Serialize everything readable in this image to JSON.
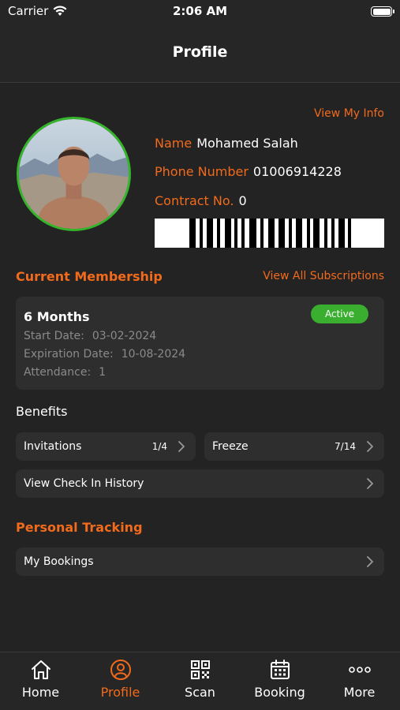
{
  "status_bar": {
    "carrier": "Carrier",
    "time": "2:06 AM"
  },
  "header": {
    "title": "Profile"
  },
  "profile": {
    "view_info_link": "View My Info",
    "name_label": "Name",
    "name": "Mohamed Salah",
    "phone_label": "Phone Number",
    "phone": "01006914228",
    "contract_label": "Contract No.",
    "contract": "0"
  },
  "membership": {
    "section_title": "Current Membership",
    "view_all_link": "View All Subscriptions",
    "plan": "6 Months",
    "status": "Active",
    "start_label": "Start Date:",
    "start_date": "03-02-2024",
    "expiration_label": "Expiration Date:",
    "expiration_date": "10-08-2024",
    "attendance_label": "Attendance:",
    "attendance": "1"
  },
  "benefits": {
    "title": "Benefits",
    "invitations_label": "Invitations",
    "invitations_count": "1/4",
    "freeze_label": "Freeze",
    "freeze_count": "7/14",
    "checkin_history_label": "View Check In History"
  },
  "tracking": {
    "section_title": "Personal Tracking",
    "bookings_label": "My Bookings"
  },
  "tabs": [
    {
      "label": "Home",
      "icon": "home-icon"
    },
    {
      "label": "Profile",
      "icon": "profile-icon"
    },
    {
      "label": "Scan",
      "icon": "qr-code-icon"
    },
    {
      "label": "Booking",
      "icon": "calendar-icon"
    },
    {
      "label": "More",
      "icon": "more-dots-icon"
    }
  ],
  "colors": {
    "accent": "#f26a1b",
    "active_green": "#3aae2f",
    "background": "#232323",
    "card": "#2e2e2e"
  }
}
